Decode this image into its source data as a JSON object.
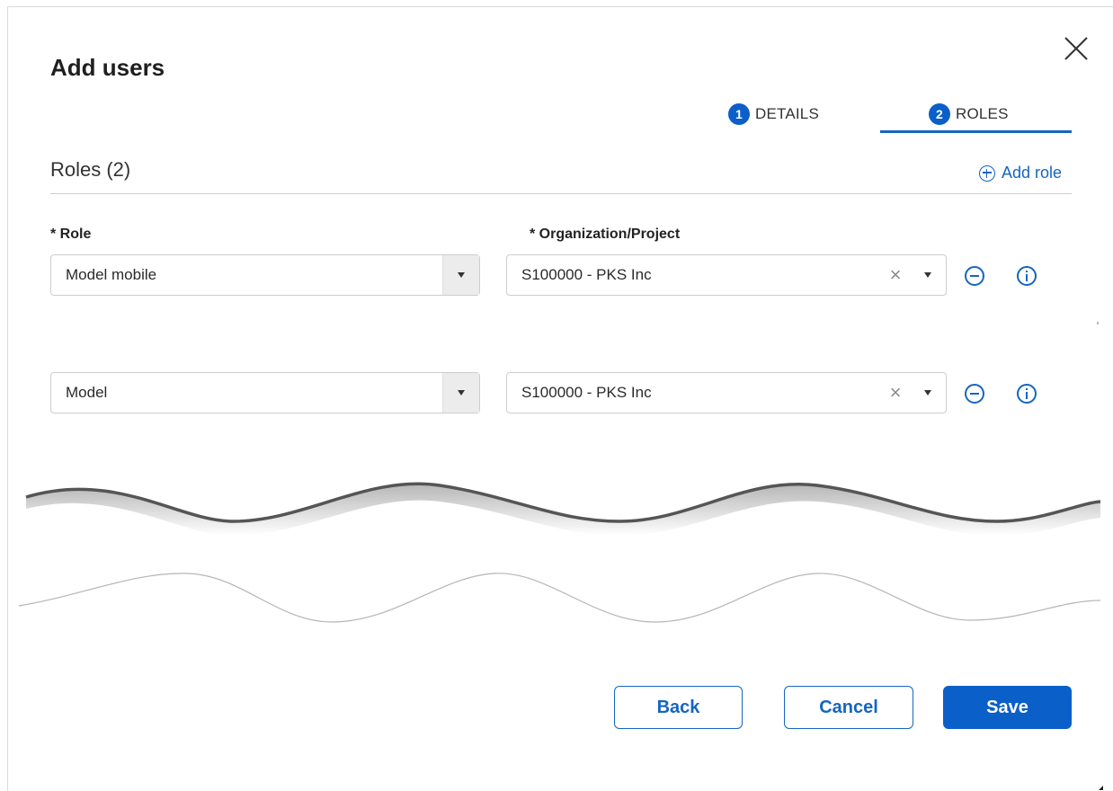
{
  "dialog": {
    "title": "Add users",
    "steps": [
      {
        "number": "1",
        "label": "DETAILS",
        "active": false
      },
      {
        "number": "2",
        "label": "ROLES",
        "active": true
      }
    ]
  },
  "roles_section": {
    "title": "Roles (2)",
    "add_role_label": "Add role",
    "role_label": "* Role",
    "org_label": "* Organization/Project",
    "rows": [
      {
        "role": "Model mobile",
        "org": "S100000 - PKS Inc"
      },
      {
        "role": "Model",
        "org": "S100000 - PKS Inc"
      }
    ]
  },
  "footer": {
    "back_label": "Back",
    "cancel_label": "Cancel",
    "save_label": "Save"
  },
  "icons": {
    "close": "close-icon",
    "add": "plus-circle-icon",
    "remove": "minus-circle-icon",
    "info": "info-circle-icon",
    "dropdown": "caret-down-icon",
    "clear": "clear-x-icon"
  },
  "colors": {
    "accent": "#1565c0",
    "primary_button": "#0b5fc9",
    "step_badge": "#0b5fc9"
  }
}
